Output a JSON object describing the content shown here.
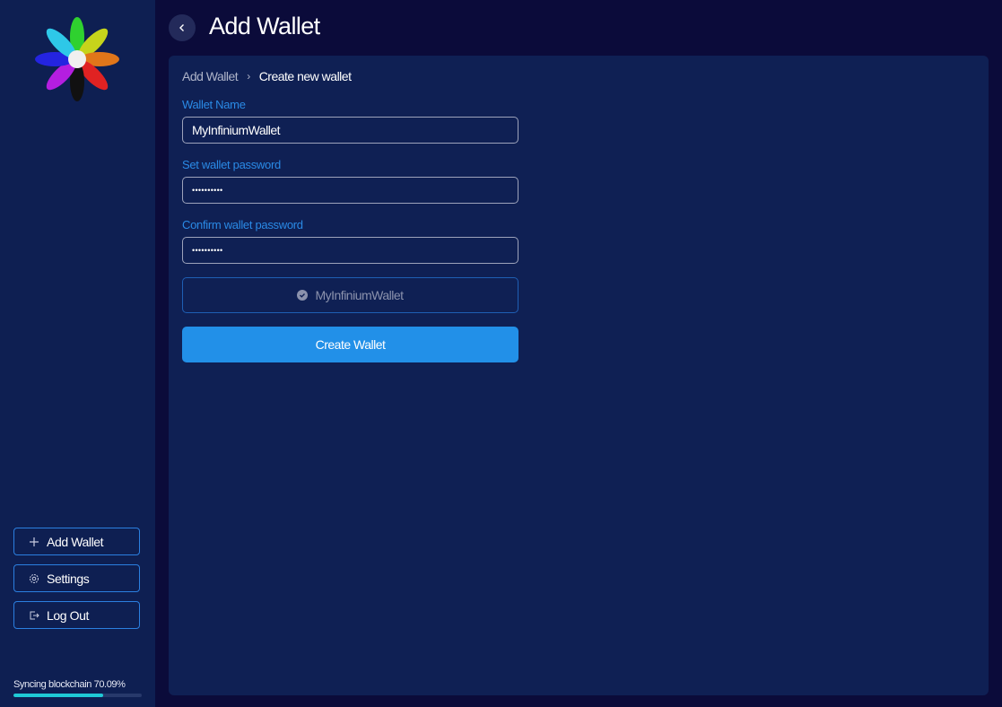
{
  "header": {
    "title": "Add Wallet",
    "back_icon": "chevron-left-icon"
  },
  "breadcrumb": {
    "items": [
      "Add Wallet",
      "Create new wallet"
    ],
    "separator_icon": "chevron-right-icon"
  },
  "form": {
    "wallet_name": {
      "label": "Wallet Name",
      "value": "MyInfiniumWallet"
    },
    "password": {
      "label": "Set wallet password",
      "value": "••••••••••"
    },
    "confirm_password": {
      "label": "Confirm wallet password",
      "value": "••••••••••"
    },
    "preview": {
      "icon": "check-circle-icon",
      "text": "MyInfiniumWallet"
    },
    "submit_label": "Create Wallet"
  },
  "sidebar": {
    "logo": "flower-logo",
    "items": [
      {
        "label": "Add Wallet",
        "icon": "plus-icon"
      },
      {
        "label": "Settings",
        "icon": "gear-icon"
      },
      {
        "label": "Log Out",
        "icon": "logout-icon"
      }
    ],
    "sync": {
      "label": "Syncing blockchain 70.09%",
      "progress": 0.7009
    }
  },
  "colors": {
    "accent": "#2290e8",
    "sync": "#1fcad6",
    "label": "#2a8ae6"
  }
}
